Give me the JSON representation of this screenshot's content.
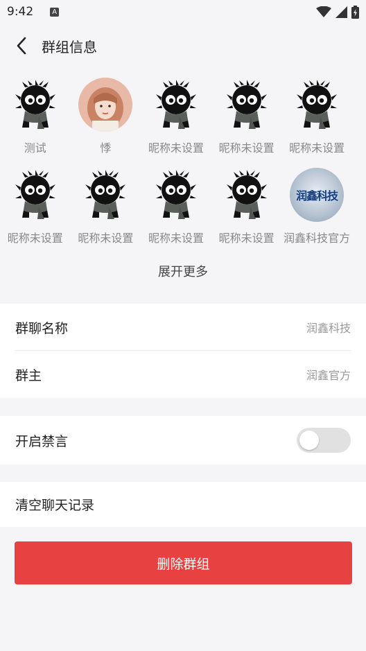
{
  "status_bar": {
    "time": "9:42",
    "badge": "A"
  },
  "header": {
    "title": "群组信息",
    "back_icon": "chevron-left-icon"
  },
  "members": [
    {
      "name": "测试",
      "avatar": "soot-sprite"
    },
    {
      "name": "悸",
      "avatar": "photo-girl"
    },
    {
      "name": "昵称未设置",
      "avatar": "soot-sprite"
    },
    {
      "name": "昵称未设置",
      "avatar": "soot-sprite"
    },
    {
      "name": "昵称未设置",
      "avatar": "soot-sprite"
    },
    {
      "name": "昵称未设置",
      "avatar": "soot-sprite"
    },
    {
      "name": "昵称未设置",
      "avatar": "soot-sprite"
    },
    {
      "name": "昵称未设置",
      "avatar": "soot-sprite"
    },
    {
      "name": "昵称未设置",
      "avatar": "soot-sprite"
    },
    {
      "name": "润鑫科技官方",
      "avatar": "logo",
      "logo_text": "润鑫科技"
    }
  ],
  "expand_more": "展开更多",
  "group_name": {
    "label": "群聊名称",
    "value": "润鑫科技"
  },
  "group_owner": {
    "label": "群主",
    "value": "润鑫官方"
  },
  "mute": {
    "label": "开启禁言",
    "enabled": false
  },
  "clear_history": {
    "label": "清空聊天记录"
  },
  "delete_button": {
    "label": "删除群组"
  },
  "colors": {
    "background": "#f5f5f7",
    "danger": "#e84141",
    "toggle_off": "#e1e1e1"
  }
}
